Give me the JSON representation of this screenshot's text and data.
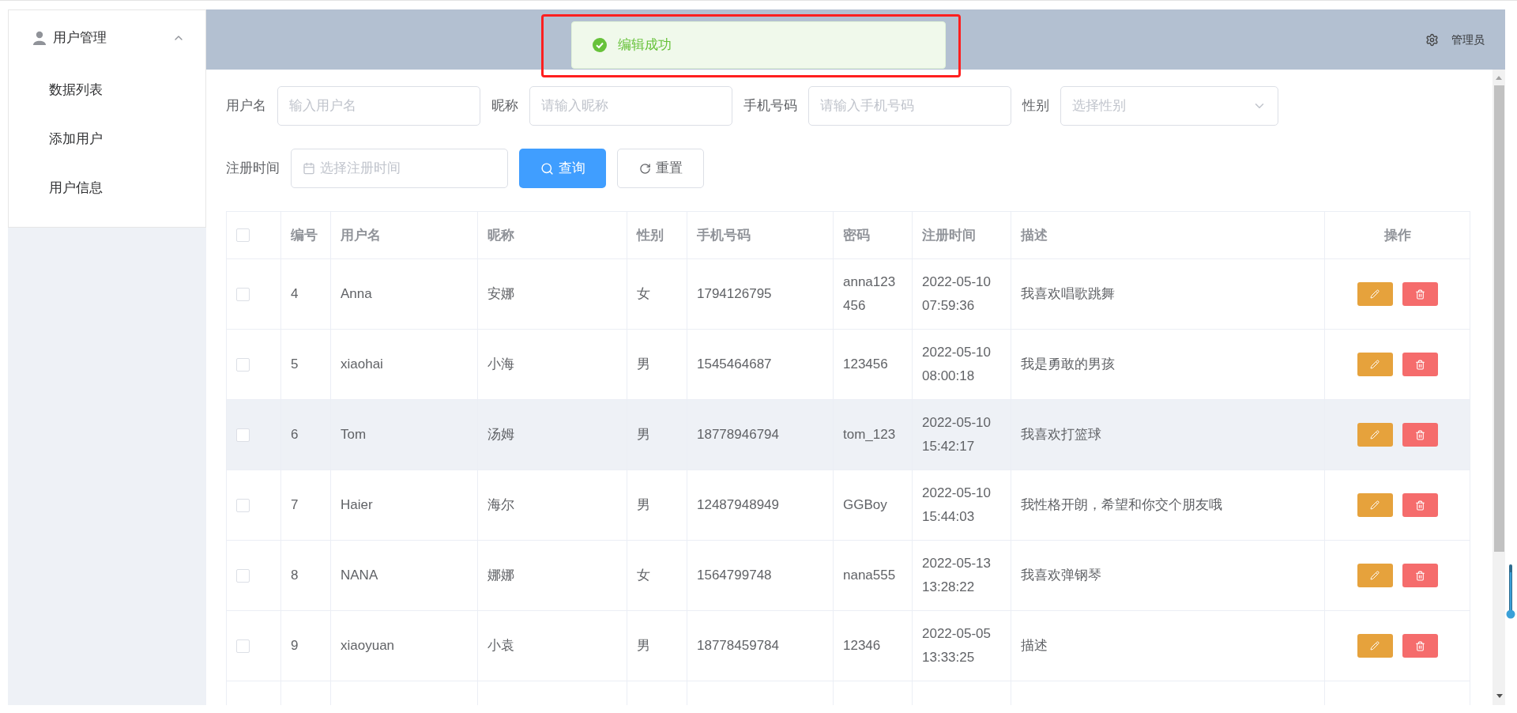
{
  "sidebar": {
    "menu": {
      "label": "用户管理",
      "expanded": true,
      "items": [
        {
          "label": "数据列表",
          "selected": false
        },
        {
          "label": "添加用户",
          "selected": false
        },
        {
          "label": "用户信息",
          "selected": false
        }
      ]
    }
  },
  "header": {
    "user": "管理员"
  },
  "toast": {
    "kind": "success",
    "message": "编辑成功"
  },
  "filter_rows": [
    {
      "fields": [
        {
          "kind": "input",
          "label": "用户名",
          "placeholder": "输入用户名"
        },
        {
          "kind": "input",
          "label": "昵称",
          "placeholder": "请输入昵称"
        },
        {
          "kind": "input",
          "label": "手机号码",
          "placeholder": "请输入手机号码"
        },
        {
          "kind": "select",
          "label": "性别",
          "placeholder": "选择性别"
        }
      ],
      "buttons": []
    },
    {
      "fields": [
        {
          "kind": "date",
          "label": "注册时间",
          "placeholder": "选择注册时间"
        }
      ],
      "buttons": [
        {
          "kind": "primary",
          "label": "查询"
        },
        {
          "kind": "default",
          "label": "重置"
        }
      ]
    }
  ],
  "table": {
    "select_all_checked": false,
    "columns": [
      "编号",
      "用户名",
      "昵称",
      "性别",
      "手机号码",
      "密码",
      "注册时间",
      "描述",
      "操作"
    ],
    "rows": [
      {
        "checked": false,
        "highlighted": false,
        "cells": [
          "4",
          "Anna",
          "安娜",
          "女",
          "1794126795",
          "anna123456",
          "2022-05-10 07:59:36",
          "我喜欢唱歌跳舞"
        ]
      },
      {
        "checked": false,
        "highlighted": false,
        "cells": [
          "5",
          "xiaohai",
          "小海",
          "男",
          "1545464687",
          "123456",
          "2022-05-10 08:00:18",
          "我是勇敢的男孩"
        ]
      },
      {
        "checked": false,
        "highlighted": true,
        "cells": [
          "6",
          "Tom",
          "汤姆",
          "男",
          "18778946794",
          "tom_123",
          "2022-05-10 15:42:17",
          "我喜欢打篮球"
        ]
      },
      {
        "checked": false,
        "highlighted": false,
        "cells": [
          "7",
          "Haier",
          "海尔",
          "男",
          "12487948949",
          "GGBoy",
          "2022-05-10 15:44:03",
          "我性格开朗，希望和你交个朋友哦"
        ]
      },
      {
        "checked": false,
        "highlighted": false,
        "cells": [
          "8",
          "NANA",
          "娜娜",
          "女",
          "1564799748",
          "nana555",
          "2022-05-13 13:28:22",
          "我喜欢弹钢琴"
        ]
      },
      {
        "checked": false,
        "highlighted": false,
        "cells": [
          "9",
          "xiaoyuan",
          "小袁",
          "男",
          "18778459784",
          "12346",
          "2022-05-05 13:33:25",
          "描述"
        ]
      }
    ]
  }
}
